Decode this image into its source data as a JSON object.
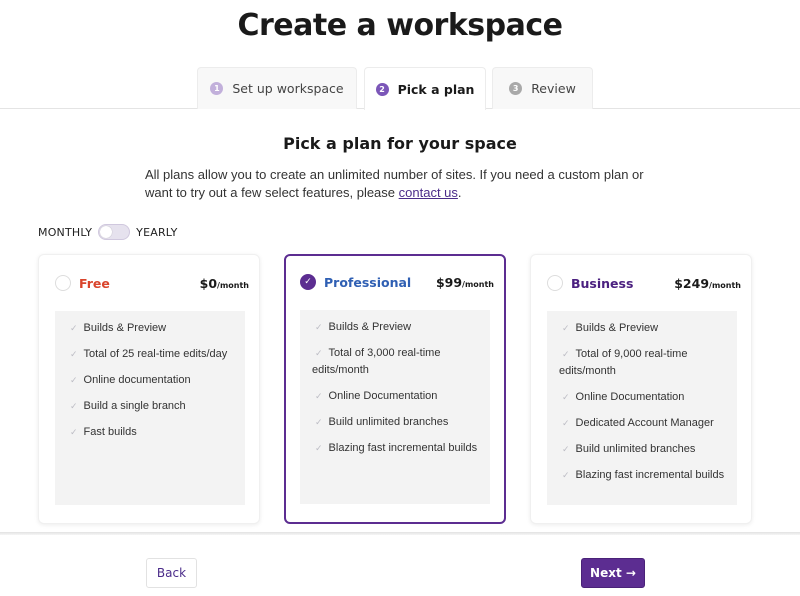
{
  "page": {
    "title": "Create a workspace"
  },
  "tabs": [
    {
      "num": "1",
      "label": "Set up workspace",
      "state": "complete"
    },
    {
      "num": "2",
      "label": "Pick a plan",
      "state": "active"
    },
    {
      "num": "3",
      "label": "Review",
      "state": "pending"
    }
  ],
  "section": {
    "title": "Pick a plan for your space",
    "description": "All plans allow you to create an unlimited number of sites. If you need a custom plan or want to try out a few select features, please ",
    "link_text": "contact us",
    "description_end": "."
  },
  "billing": {
    "left_label": "MONTHLY",
    "right_label": "YEARLY",
    "selected": "MONTHLY"
  },
  "plans": [
    {
      "name": "Free",
      "price": "$0",
      "per": "/month",
      "selected": false,
      "color": "#d9442b",
      "features": [
        "Builds & Preview",
        "Total of 25 real-time edits/day",
        "Online documentation",
        "Build a single branch",
        "Fast builds"
      ]
    },
    {
      "name": "Professional",
      "price": "$99",
      "per": "/month",
      "selected": true,
      "color": "#2f5fb3",
      "features": [
        "Builds & Preview",
        "Total of 3,000 real-time edits/month",
        "Online Documentation",
        "Build unlimited branches",
        "Blazing fast incremental builds"
      ]
    },
    {
      "name": "Business",
      "price": "$249",
      "per": "/month",
      "selected": false,
      "color": "#4b2080",
      "features": [
        "Builds & Preview",
        "Total of 9,000 real-time edits/month",
        "Online Documentation",
        "Dedicated Account Manager",
        "Build unlimited branches",
        "Blazing fast incremental builds"
      ]
    }
  ],
  "footer": {
    "back_label": "Back",
    "next_label": "Next →"
  },
  "colors": {
    "accent": "#5c2d91"
  }
}
